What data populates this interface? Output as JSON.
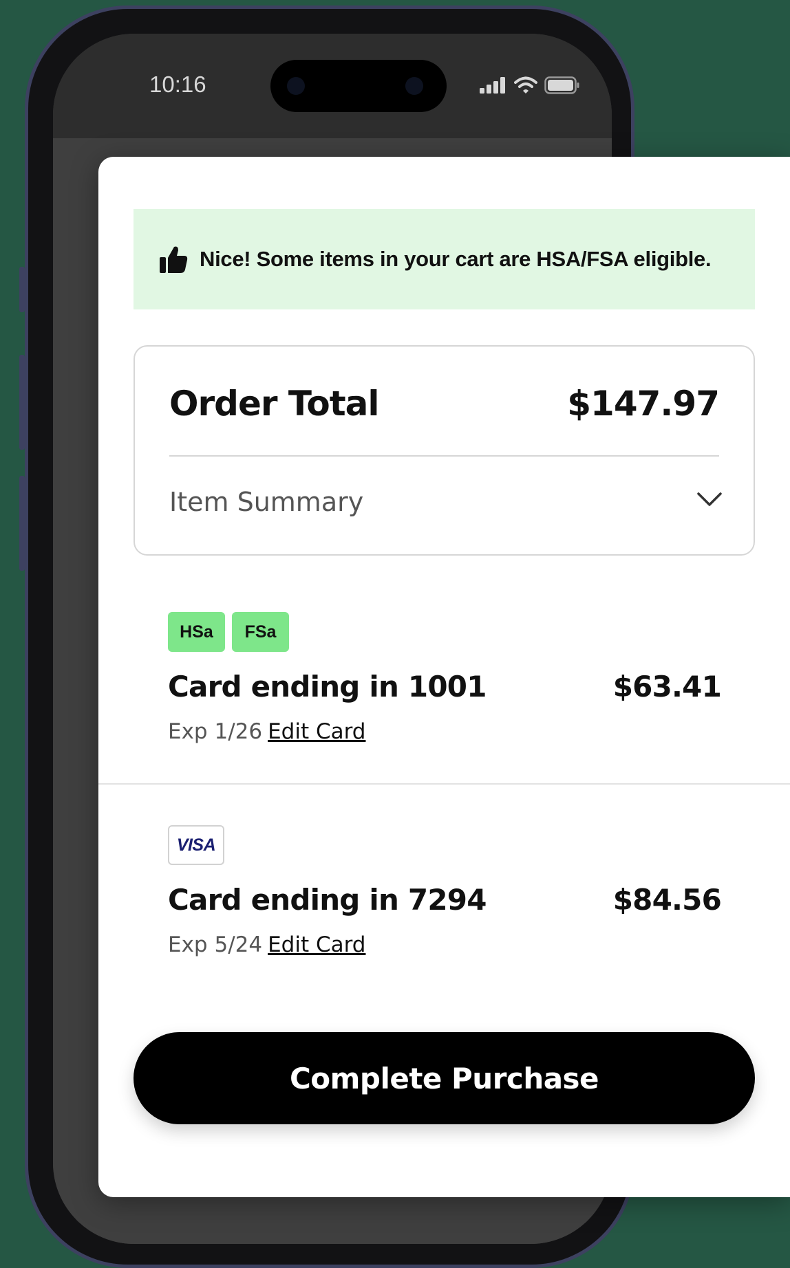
{
  "status_bar": {
    "time": "10:16",
    "icons": [
      "cellular-signal-icon",
      "wifi-icon",
      "battery-icon"
    ]
  },
  "banner": {
    "icon": "thumbs-up-icon",
    "text": "Nice! Some items in your cart are HSA/FSA eligible.",
    "background": "#e1f7e3"
  },
  "order": {
    "title": "Order Total",
    "amount": "$147.97",
    "summary_label": "Item Summary",
    "summary_icon": "chevron-down-icon"
  },
  "payments": [
    {
      "badges": [
        "HSa",
        "FSa"
      ],
      "name": "Card ending in 1001",
      "amount": "$63.41",
      "exp": "Exp 1/26",
      "edit_label": "Edit Card"
    },
    {
      "brand": "VISA",
      "name": "Card ending in 7294",
      "amount": "$84.56",
      "exp": "Exp 5/24",
      "edit_label": "Edit Card"
    }
  ],
  "cta": {
    "label": "Complete Purchase"
  },
  "colors": {
    "background": "#255744",
    "badge_green": "#7ee68a",
    "visa_blue": "#1a1f71",
    "cta": "#000000"
  }
}
